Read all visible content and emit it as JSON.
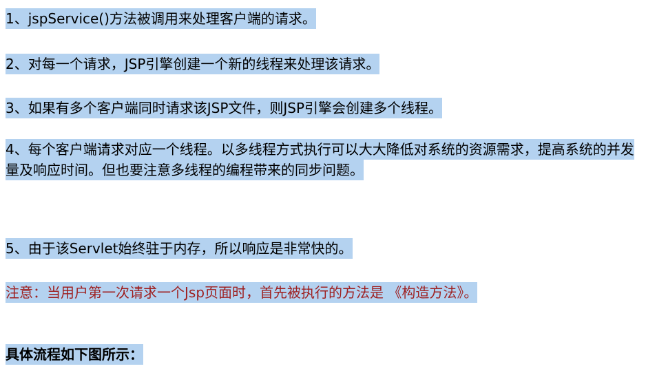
{
  "document": {
    "language": "zh-CN",
    "background_color": "#ffffff",
    "highlight_color": "#b4d2f0",
    "body_text_color": "#000000",
    "note_text_color": "#9e1f1f",
    "paragraphs": [
      {
        "id": "item-1",
        "index": "1",
        "text": "1、jspService()方法被调用来处理客户端的请求。",
        "highlighted": true,
        "color": "#000000",
        "bold": false
      },
      {
        "id": "item-2",
        "index": "2",
        "text": "2、对每一个请求，JSP引擎创建一个新的线程来处理该请求。",
        "highlighted": true,
        "color": "#000000",
        "bold": false
      },
      {
        "id": "item-3",
        "index": "3",
        "text": "3、如果有多个客户端同时请求该JSP文件，则JSP引擎会创建多个线程。",
        "highlighted": true,
        "color": "#000000",
        "bold": false
      },
      {
        "id": "item-4",
        "index": "4",
        "text": "4、每个客户端请求对应一个线程。以多线程方式执行可以大大降低对系统的资源需求，提高系统的并发量及响应时间。但也要注意多线程的编程带来的同步问题。",
        "highlighted": true,
        "color": "#000000",
        "bold": false,
        "wraps": 3
      },
      {
        "id": "item-5",
        "index": "5",
        "text": "5、由于该Servlet始终驻于内存，所以响应是非常快的。",
        "highlighted": true,
        "color": "#000000",
        "bold": false
      },
      {
        "id": "note",
        "index": "",
        "text": "注意：当用户第一次请求一个Jsp页面时，首先被执行的方法是 《构造方法》。",
        "highlighted": true,
        "color": "#9e1f1f",
        "bold": false
      },
      {
        "id": "closing",
        "index": "",
        "text": "具体流程如下图所示：",
        "highlighted": true,
        "color": "#000000",
        "bold": true
      }
    ]
  }
}
